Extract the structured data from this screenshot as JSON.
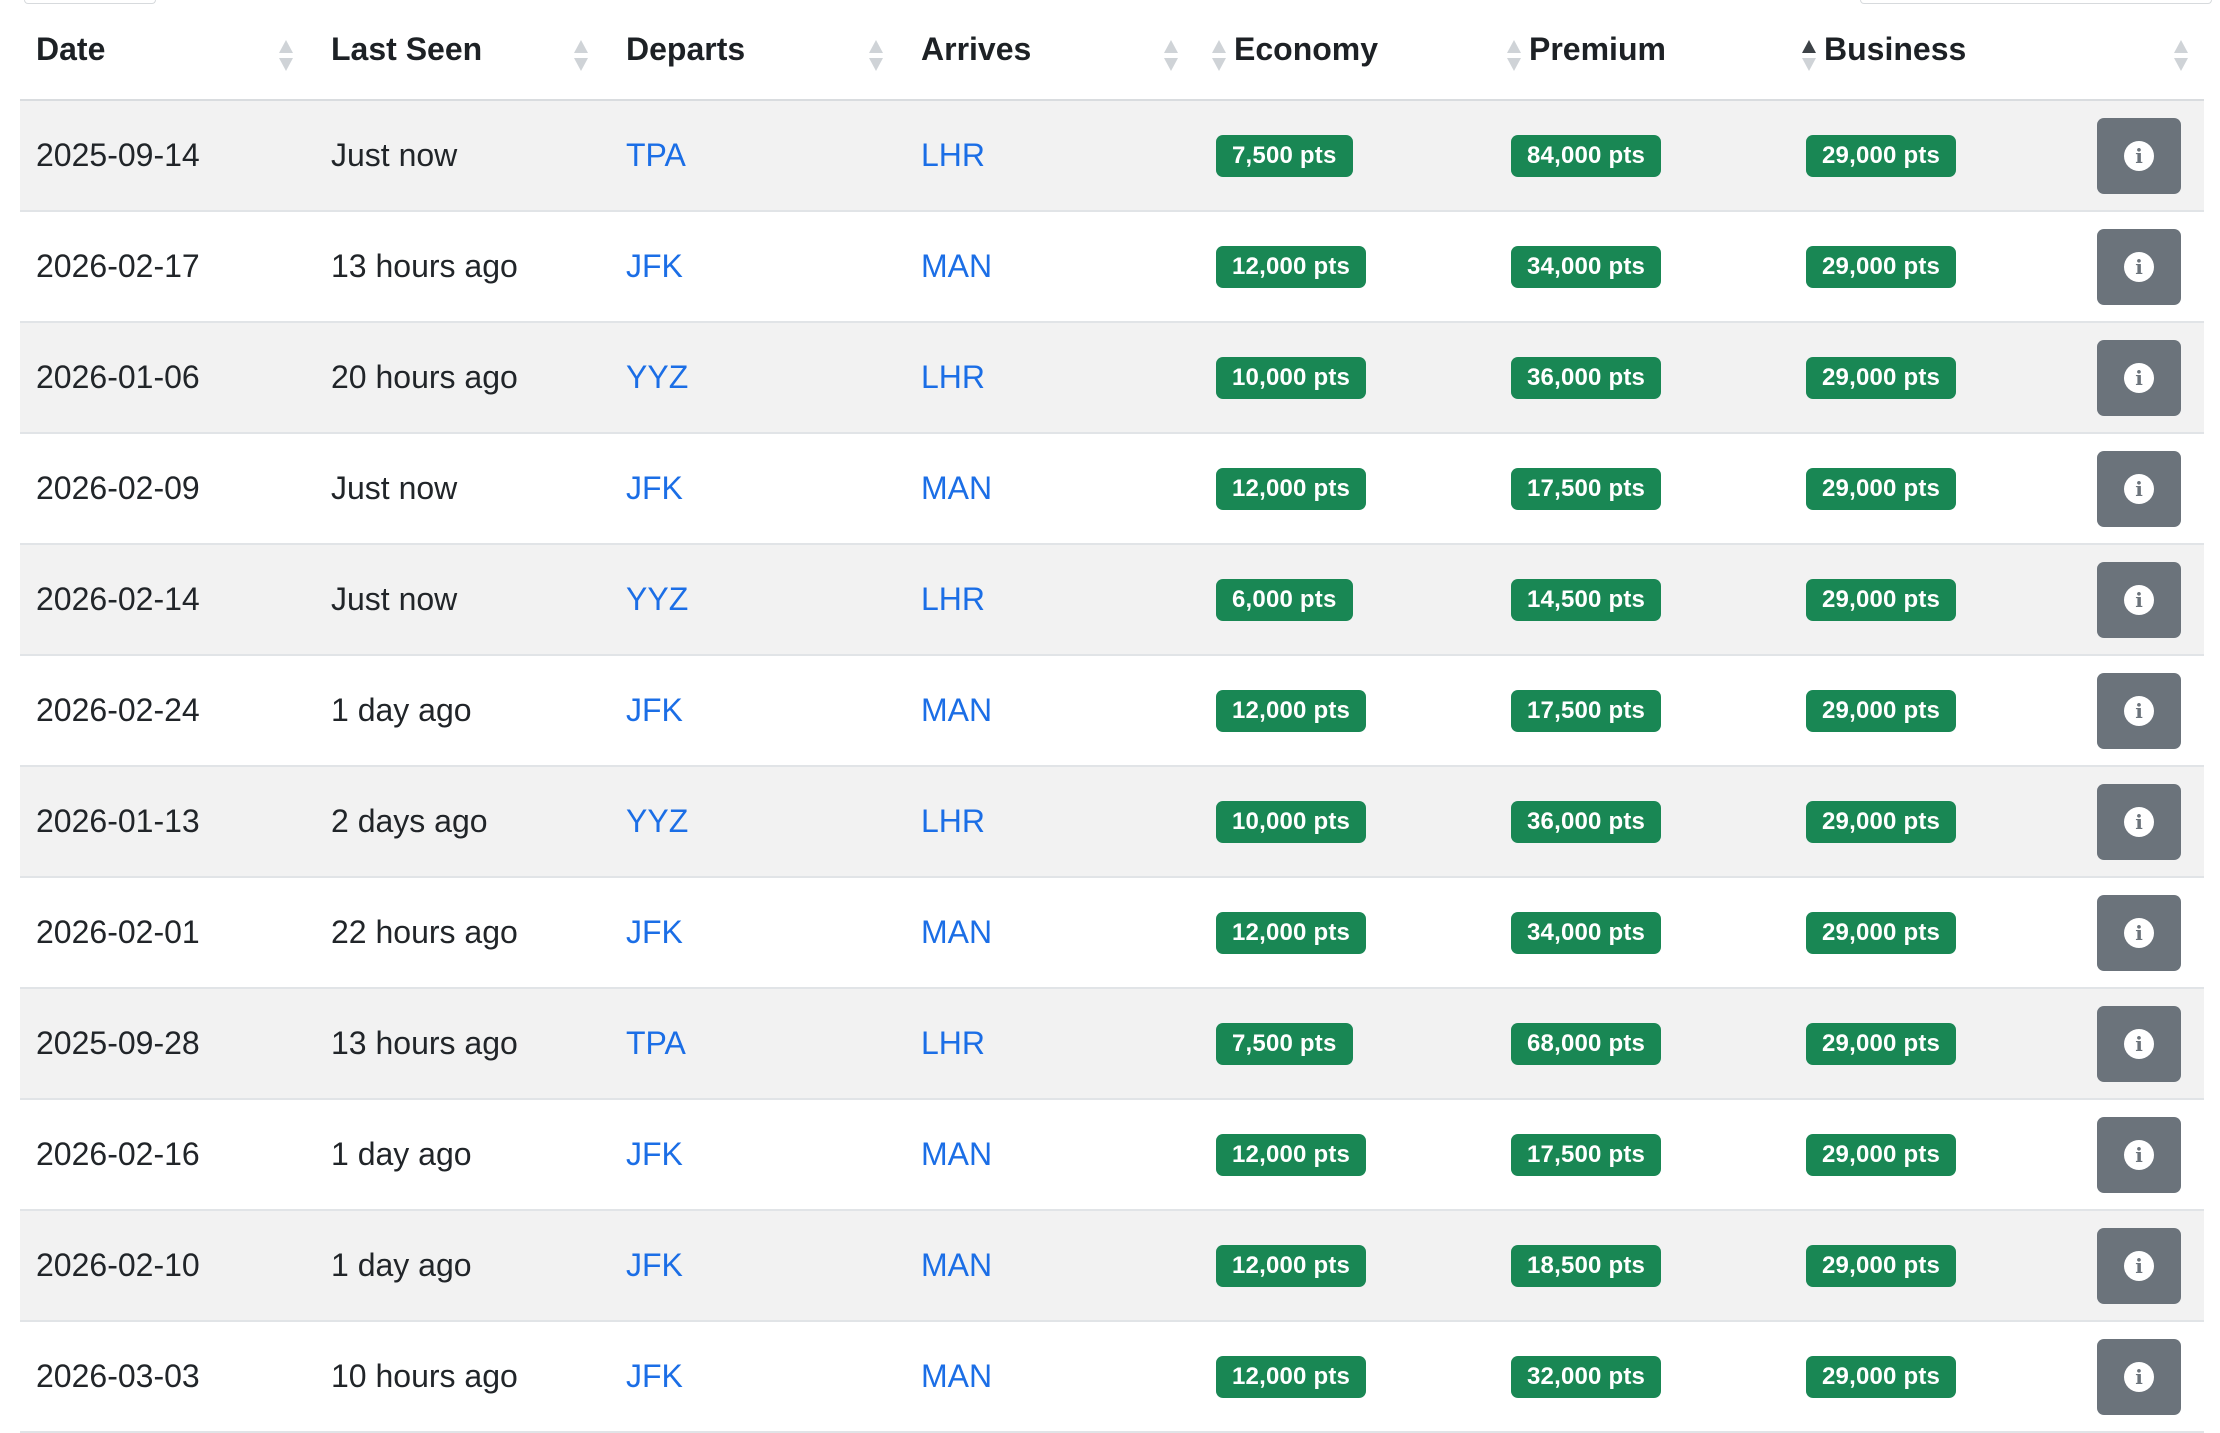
{
  "columns": {
    "date": "Date",
    "last_seen": "Last Seen",
    "departs": "Departs",
    "arrives": "Arrives",
    "economy": "Economy",
    "premium": "Premium",
    "business": "Business"
  },
  "sorted_column": "business",
  "info_icon_glyph": "i",
  "colors": {
    "badge": "#198754",
    "link": "#1b6ee6",
    "info_button": "#6b737b"
  },
  "rows": [
    {
      "date": "2025-09-14",
      "last_seen": "Just now",
      "departs": "TPA",
      "arrives": "LHR",
      "economy": "7,500 pts",
      "premium": "84,000 pts",
      "business": "29,000 pts"
    },
    {
      "date": "2026-02-17",
      "last_seen": "13 hours ago",
      "departs": "JFK",
      "arrives": "MAN",
      "economy": "12,000 pts",
      "premium": "34,000 pts",
      "business": "29,000 pts"
    },
    {
      "date": "2026-01-06",
      "last_seen": "20 hours ago",
      "departs": "YYZ",
      "arrives": "LHR",
      "economy": "10,000 pts",
      "premium": "36,000 pts",
      "business": "29,000 pts"
    },
    {
      "date": "2026-02-09",
      "last_seen": "Just now",
      "departs": "JFK",
      "arrives": "MAN",
      "economy": "12,000 pts",
      "premium": "17,500 pts",
      "business": "29,000 pts"
    },
    {
      "date": "2026-02-14",
      "last_seen": "Just now",
      "departs": "YYZ",
      "arrives": "LHR",
      "economy": "6,000 pts",
      "premium": "14,500 pts",
      "business": "29,000 pts"
    },
    {
      "date": "2026-02-24",
      "last_seen": "1 day ago",
      "departs": "JFK",
      "arrives": "MAN",
      "economy": "12,000 pts",
      "premium": "17,500 pts",
      "business": "29,000 pts"
    },
    {
      "date": "2026-01-13",
      "last_seen": "2 days ago",
      "departs": "YYZ",
      "arrives": "LHR",
      "economy": "10,000 pts",
      "premium": "36,000 pts",
      "business": "29,000 pts"
    },
    {
      "date": "2026-02-01",
      "last_seen": "22 hours ago",
      "departs": "JFK",
      "arrives": "MAN",
      "economy": "12,000 pts",
      "premium": "34,000 pts",
      "business": "29,000 pts"
    },
    {
      "date": "2025-09-28",
      "last_seen": "13 hours ago",
      "departs": "TPA",
      "arrives": "LHR",
      "economy": "7,500 pts",
      "premium": "68,000 pts",
      "business": "29,000 pts"
    },
    {
      "date": "2026-02-16",
      "last_seen": "1 day ago",
      "departs": "JFK",
      "arrives": "MAN",
      "economy": "12,000 pts",
      "premium": "17,500 pts",
      "business": "29,000 pts"
    },
    {
      "date": "2026-02-10",
      "last_seen": "1 day ago",
      "departs": "JFK",
      "arrives": "MAN",
      "economy": "12,000 pts",
      "premium": "18,500 pts",
      "business": "29,000 pts"
    },
    {
      "date": "2026-03-03",
      "last_seen": "10 hours ago",
      "departs": "JFK",
      "arrives": "MAN",
      "economy": "12,000 pts",
      "premium": "32,000 pts",
      "business": "29,000 pts"
    }
  ]
}
